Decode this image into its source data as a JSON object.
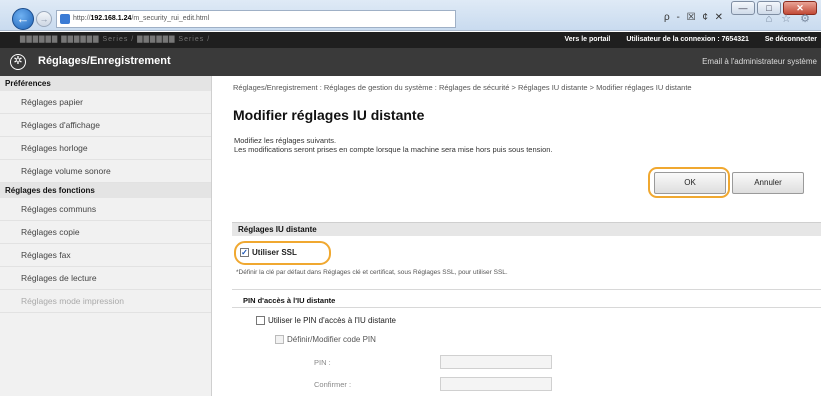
{
  "window": {
    "min_label": "—",
    "max_label": "□",
    "close_label": "✕"
  },
  "browser": {
    "back_label": "←",
    "forward_label": "→",
    "url_prefix": "http://",
    "url_host": "192.168.1.24",
    "url_path": "/m_security_rui_edit.html",
    "addr_tools": "ρ - ☒ ¢ ✕",
    "right_icons": "⌂ ☆ ⚙"
  },
  "header": {
    "device_name": "▇▇▇▇▇▇   ▇▇▇▇▇▇ Series / ▇▇▇▇▇▇ Series /",
    "portal_link": "Vers le portail",
    "user_label": "Utilisateur de la connexion : 7654321",
    "logout_link": "Se déconnecter"
  },
  "app": {
    "icon": "✲",
    "title": "Réglages/Enregistrement",
    "admin_mail": "Email à l'administrateur système"
  },
  "sidebar": {
    "section1": "Préférences",
    "items1": [
      "Réglages papier",
      "Réglages d'affichage",
      "Réglages horloge",
      "Réglage volume sonore"
    ],
    "section2": "Réglages des fonctions",
    "items2": [
      "Réglages communs",
      "Réglages copie",
      "Réglages fax",
      "Réglages de lecture",
      "Réglages mode impression"
    ]
  },
  "main": {
    "breadcrumb": "Réglages/Enregistrement : Réglages de gestion du système : Réglages de sécurité > Réglages IU distante > Modifier réglages IU distante",
    "title": "Modifier réglages IU distante",
    "desc1": "Modifiez les réglages suivants.",
    "desc2": "Les modifications seront prises en compte lorsque la machine sera mise hors puis sous tension.",
    "ok_label": "OK",
    "cancel_label": "Annuler",
    "section_title": "Réglages IU distante",
    "use_ssl_label": "Utiliser SSL",
    "use_ssl_checked": "✓",
    "ssl_note": "*Définir la clé par défaut dans Réglages clé et certificat, sous Réglages SSL, pour utiliser SSL.",
    "pin_section": "PIN d'accès à l'IU distante",
    "use_pin_label": "Utiliser le PIN d'accès à l'IU distante",
    "define_pin_label": "Définir/Modifier code PIN",
    "pin_label": "PIN :",
    "confirm_label": "Confirmer :"
  }
}
